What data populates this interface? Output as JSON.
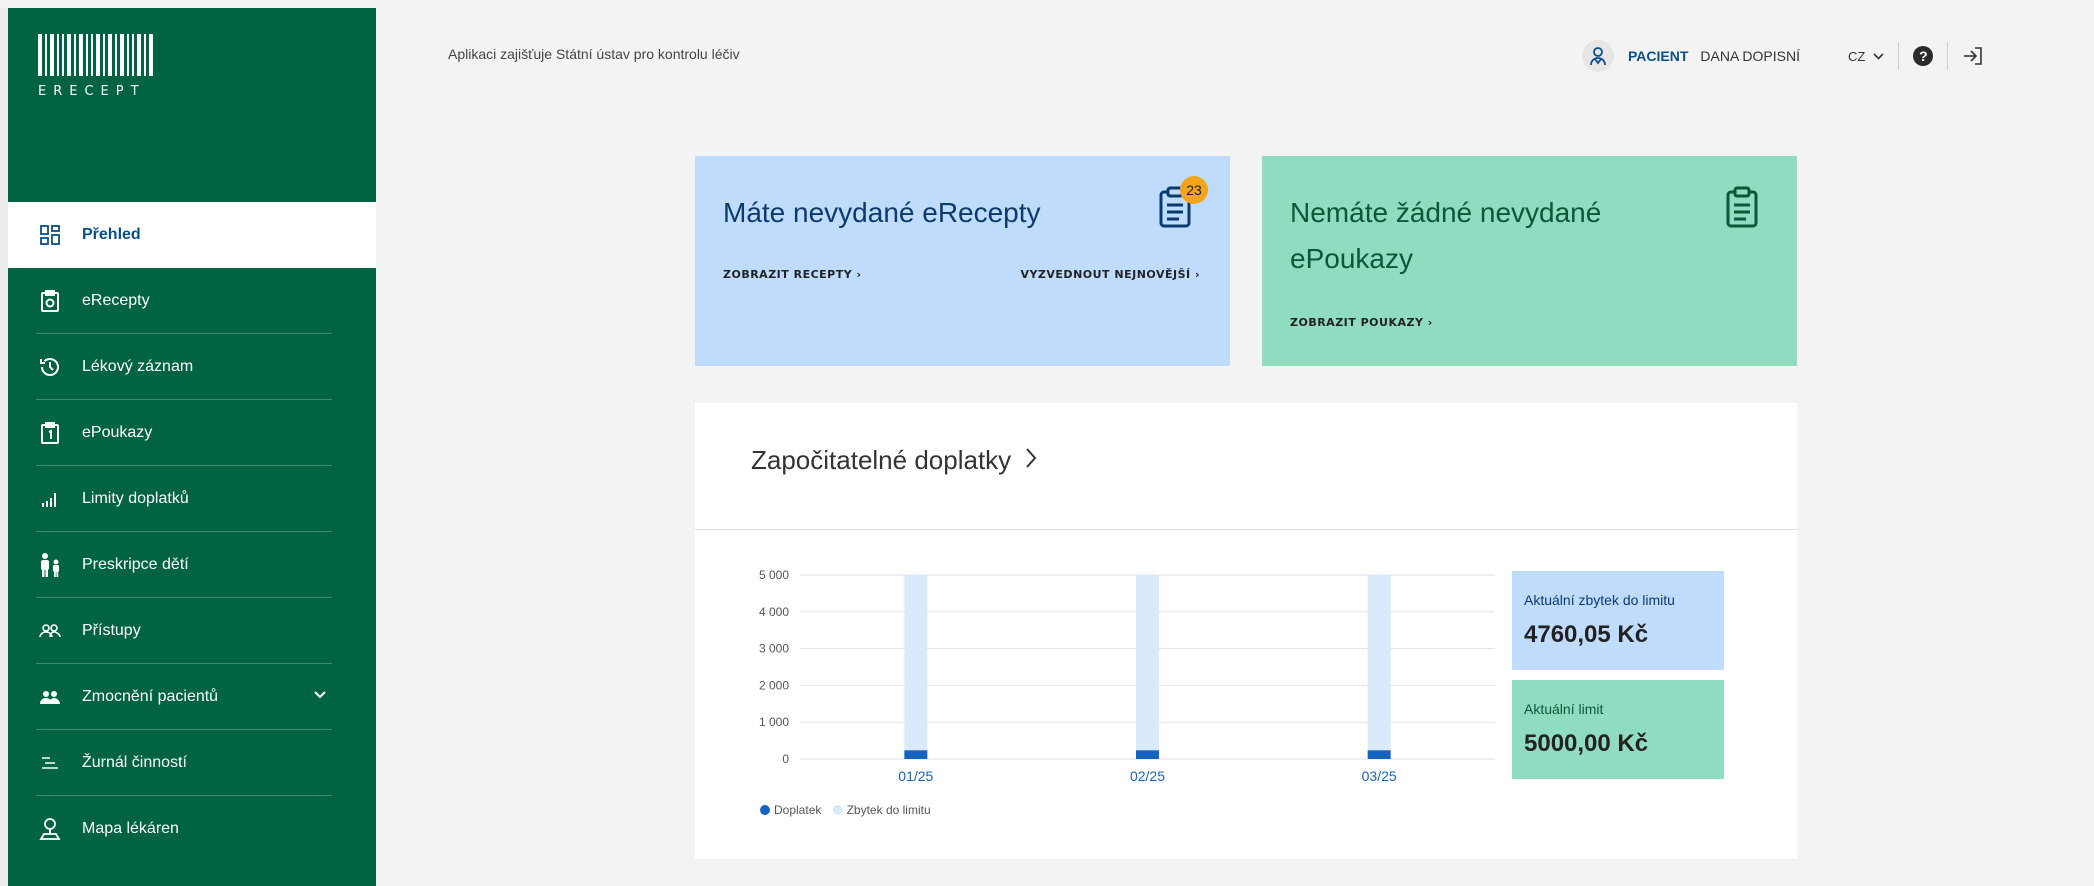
{
  "app": {
    "logo_text": "ERECEPT"
  },
  "header": {
    "note": "Aplikaci zajišťuje Státní ústav pro kontrolu léčiv",
    "role": "PACIENT",
    "user": "DANA DOPISNÍ",
    "lang": "CZ"
  },
  "sidebar": {
    "items": [
      {
        "label": "Přehled",
        "icon": "dashboard-icon",
        "active": true
      },
      {
        "label": "eRecepty",
        "icon": "prescription-icon"
      },
      {
        "label": "Lékový záznam",
        "icon": "history-icon"
      },
      {
        "label": "ePoukazy",
        "icon": "voucher-icon"
      },
      {
        "label": "Limity doplatků",
        "icon": "bar-chart-icon"
      },
      {
        "label": "Preskripce dětí",
        "icon": "family-icon"
      },
      {
        "label": "Přístupy",
        "icon": "people-icon"
      },
      {
        "label": "Zmocnění pacientů",
        "icon": "group-icon",
        "expandable": true
      },
      {
        "label": "Žurnál činností",
        "icon": "list-icon"
      },
      {
        "label": "Mapa lékáren",
        "icon": "map-person-icon"
      }
    ]
  },
  "cards": {
    "erecepty": {
      "title": "Máte nevydané eRecepty",
      "badge": "23",
      "link_show": "ZOBRAZIT RECEPTY",
      "link_pick": "VYZVEDNOUT NEJNOVĚJŠÍ"
    },
    "epoukazy": {
      "title": "Nemáte žádné nevydané ePoukazy",
      "link_show": "ZOBRAZIT POUKAZY"
    }
  },
  "panel": {
    "title": "Započitatelné doplatky",
    "stat_remaining_label": "Aktuální zbytek do limitu",
    "stat_remaining_value": "4760,05 Kč",
    "stat_limit_label": "Aktuální limit",
    "stat_limit_value": "5000,00 Kč"
  },
  "chart_data": {
    "type": "bar",
    "stacked": true,
    "categories": [
      "01/25",
      "02/25",
      "03/25"
    ],
    "series": [
      {
        "name": "Doplatek",
        "values": [
          240,
          240,
          240
        ],
        "color": "#1565c0"
      },
      {
        "name": "Zbytek do limitu",
        "values": [
          4760,
          4760,
          4760
        ],
        "color": "#d8eafc"
      }
    ],
    "yticks": [
      "0",
      "1 000",
      "2 000",
      "3 000",
      "4 000",
      "5 000"
    ],
    "ylim": [
      0,
      5000
    ],
    "grid": true,
    "legend": "bottom-left"
  },
  "colors": {
    "brand_green": "#006341",
    "card_blue": "#bfdcfc",
    "card_green": "#90dcbe",
    "link_blue": "#0b4f8a",
    "badge": "#f3a51c"
  }
}
